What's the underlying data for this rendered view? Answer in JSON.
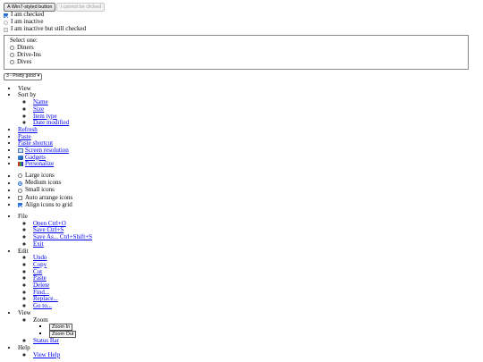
{
  "buttons": {
    "win7": "A Win7-styled button",
    "disabled": "I cannot be clicked"
  },
  "checkboxes": [
    {
      "label": "I am checked",
      "checked": true,
      "inactive": false
    },
    {
      "label": "I am inactive",
      "checked": false,
      "inactive": true
    },
    {
      "label": "I am inactive but still checked",
      "checked": true,
      "inactive": true
    }
  ],
  "radio_group": {
    "legend": "Select one:",
    "options": [
      "Diners",
      "Drive-Ins",
      "Dives"
    ]
  },
  "select": {
    "value": "3 - Pretty good"
  },
  "context_menu": {
    "view": "View",
    "sort_by": "Sort by",
    "sort_options": [
      "Name",
      "Size",
      "Item type",
      "Date modified"
    ],
    "refresh": "Refresh",
    "paste": "Paste",
    "paste_shortcut": "Paste shortcut",
    "screen_resolution": "Screen resolution",
    "gadgets": "Gadgets",
    "personalize": "Personalize"
  },
  "view_options": [
    {
      "label": "Large icons",
      "type": "radio",
      "checked": false
    },
    {
      "label": "Medium icons",
      "type": "radio",
      "checked": true
    },
    {
      "label": "Small icons",
      "type": "radio",
      "checked": false
    },
    {
      "label": "Auto arrange icons",
      "type": "checkbox",
      "checked": false
    },
    {
      "label": "Align icons to grid",
      "type": "checkbox",
      "checked": true
    }
  ],
  "menubar": {
    "file": "File",
    "file_items": [
      "Open Ctrl+O",
      "Save Ctrl+S",
      "Save As... Ctrl+Shift+S",
      "Exit"
    ],
    "edit": "Edit",
    "edit_items": [
      "Undo",
      "Copy",
      "Cut",
      "Paste",
      "Delete",
      "Find...",
      "Replace...",
      "Go to..."
    ],
    "view": "View",
    "zoom": "Zoom",
    "zoom_in": "Zoom In",
    "zoom_out": "Zoom Out",
    "status_bar": "Status Bar",
    "help": "Help",
    "view_help": "View Help"
  },
  "colors": {
    "link": "#0000ee",
    "accent": "#2a6fd6"
  }
}
